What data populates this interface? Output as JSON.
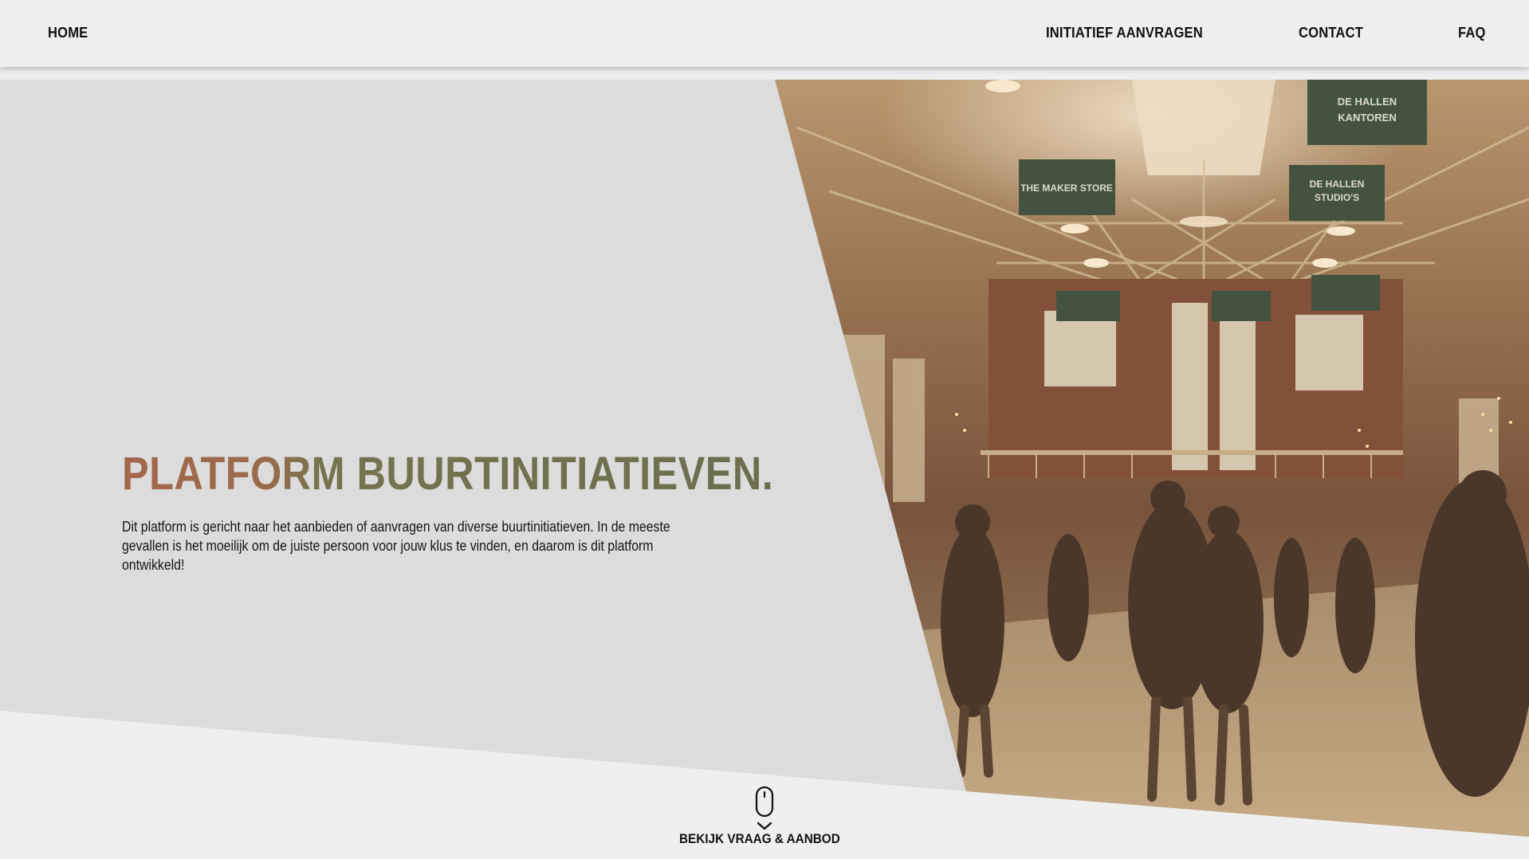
{
  "nav": {
    "home": "HOME",
    "aanvragen": "INITIATIEF AANVRAGEN",
    "contact": "CONTACT",
    "faq": "FAQ"
  },
  "hero": {
    "title": "PLATFORM BUURTINITIATIEVEN.",
    "description": "Dit platform is gericht naar het aanbieden of aanvragen van diverse buurtinitiatieven. In de meeste gevallen is het moeilijk om de juiste persoon voor jouw klus te vinden, en daarom is dit platform ontwikkeld!",
    "photo_signs": [
      "DE HALLEN KANTOREN",
      "THE MAKER STORE",
      "DE HALLEN STUDIO'S"
    ]
  },
  "scroll": {
    "label": "BEKIJK VRAAG & AANBOD",
    "icon": "mouse-icon",
    "chevron": "chevron-down-icon"
  },
  "colors": {
    "page_bg": "#efefef",
    "hero_gray": "#dcdcdc",
    "title_brown": "#a4664a",
    "title_olive": "#6b6e4e",
    "sign_green": "#2f4a3a"
  }
}
